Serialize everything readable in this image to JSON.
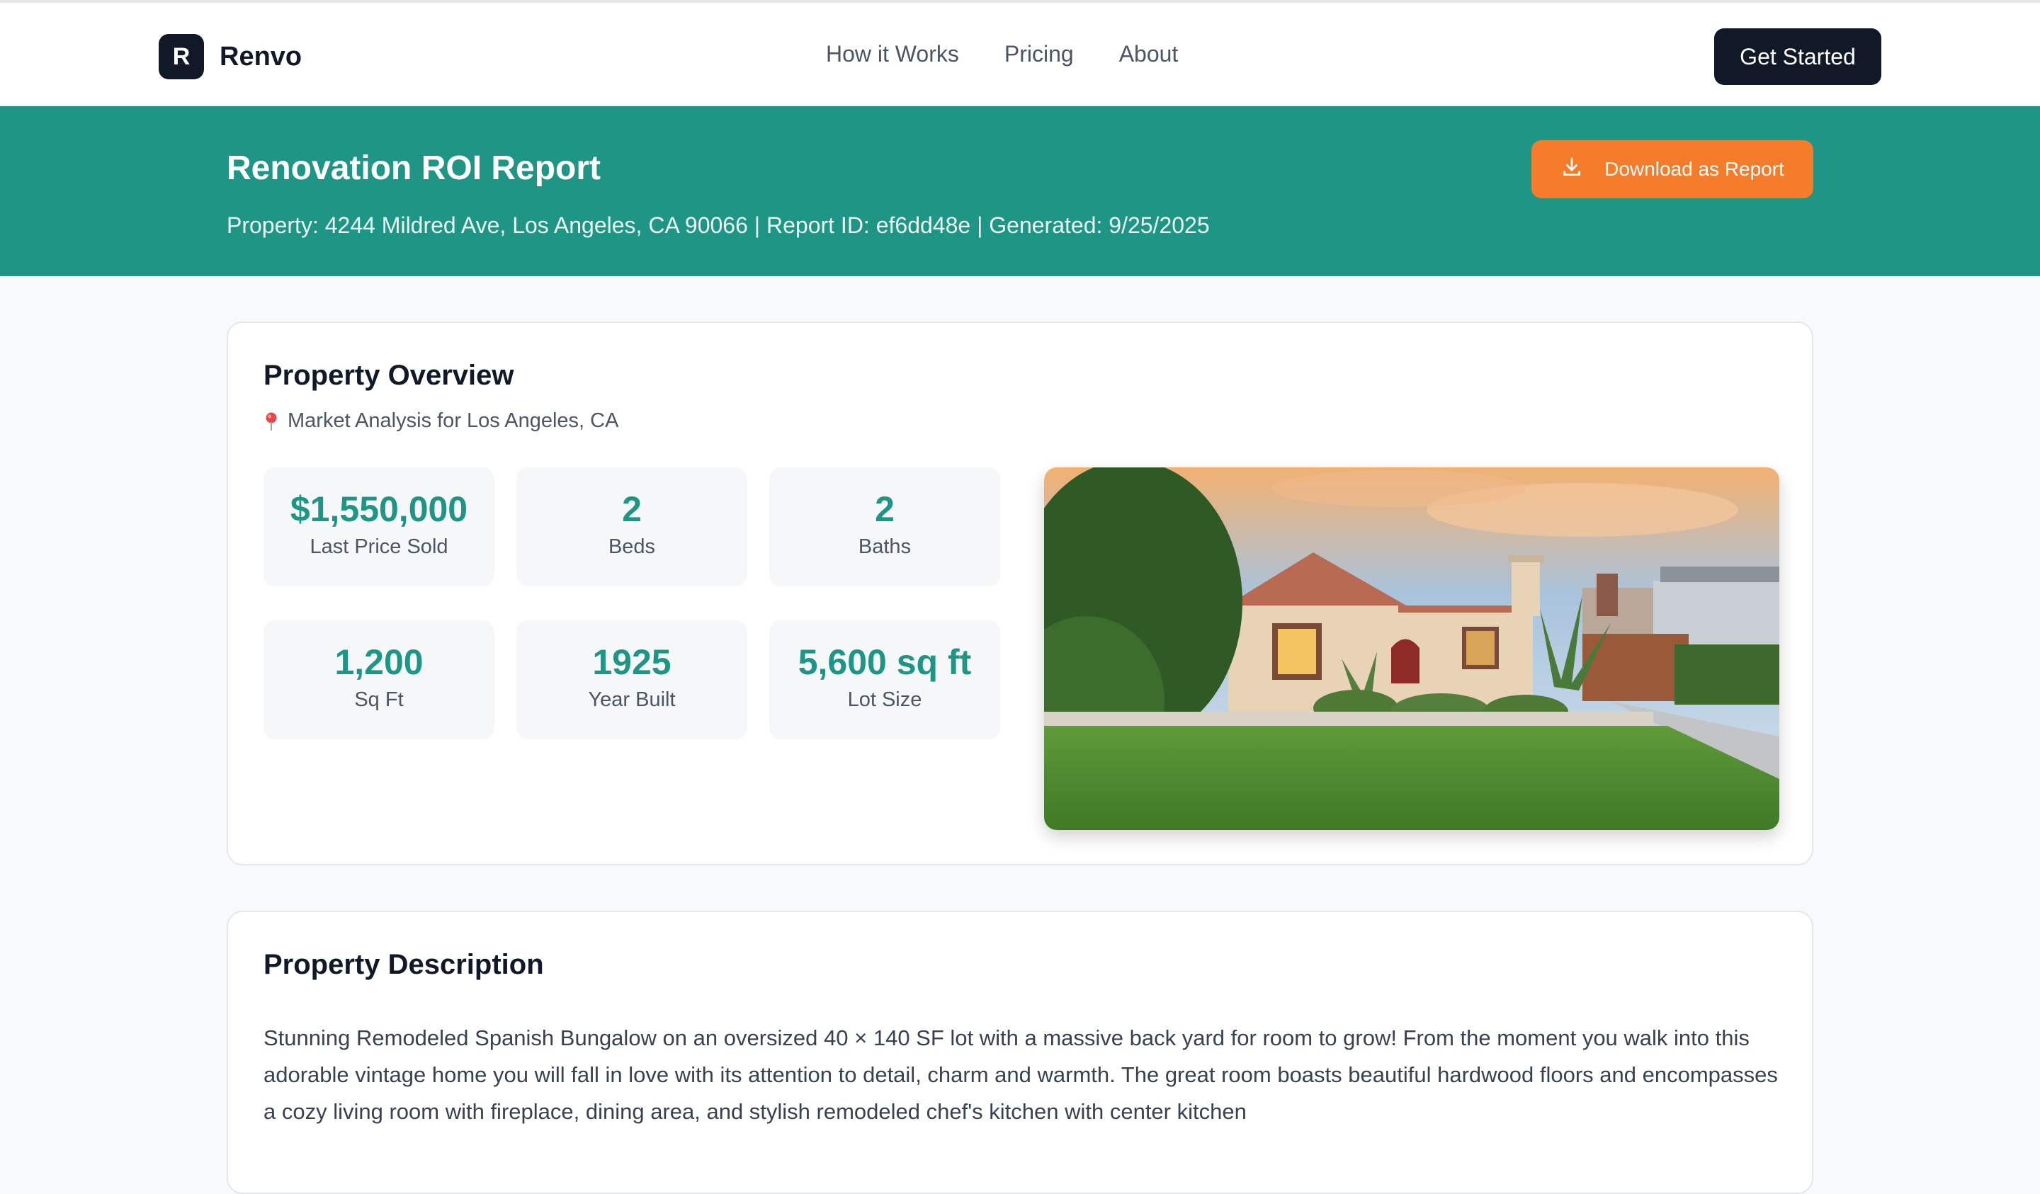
{
  "nav": {
    "brand_mark": "R",
    "brand_name": "Renvo",
    "links": [
      "How it Works",
      "Pricing",
      "About"
    ],
    "cta": "Get Started"
  },
  "banner": {
    "title": "Renovation ROI Report",
    "meta": "Property: 4244 Mildred Ave, Los Angeles, CA 90066 | Report ID: ef6dd48e | Generated: 9/25/2025",
    "download_label": "Download as Report",
    "download_icon": "download-icon"
  },
  "overview": {
    "title": "Property Overview",
    "subtitle": "Market Analysis for Los Angeles, CA",
    "subtitle_icon": "map-pin-icon",
    "stats": [
      {
        "value": "$1,550,000",
        "label": "Last Price Sold"
      },
      {
        "value": "2",
        "label": "Beds"
      },
      {
        "value": "2",
        "label": "Baths"
      },
      {
        "value": "1,200",
        "label": "Sq Ft"
      },
      {
        "value": "1925",
        "label": "Year Built"
      },
      {
        "value": "5,600 sq ft",
        "label": "Lot Size"
      }
    ]
  },
  "description": {
    "title": "Property Description",
    "text": "Stunning Remodeled Spanish Bungalow on an oversized 40 × 140 SF lot with a massive back yard for room to grow! From the moment you walk into this adorable vintage home you will fall in love with its attention to detail, charm and warmth. The great room boasts beautiful hardwood floors and encompasses a cozy living room with fireplace, dining area, and stylish remodeled chef's kitchen with center kitchen"
  },
  "colors": {
    "accent": "#1e9585",
    "download": "#f47c2a",
    "dark": "#111827"
  }
}
